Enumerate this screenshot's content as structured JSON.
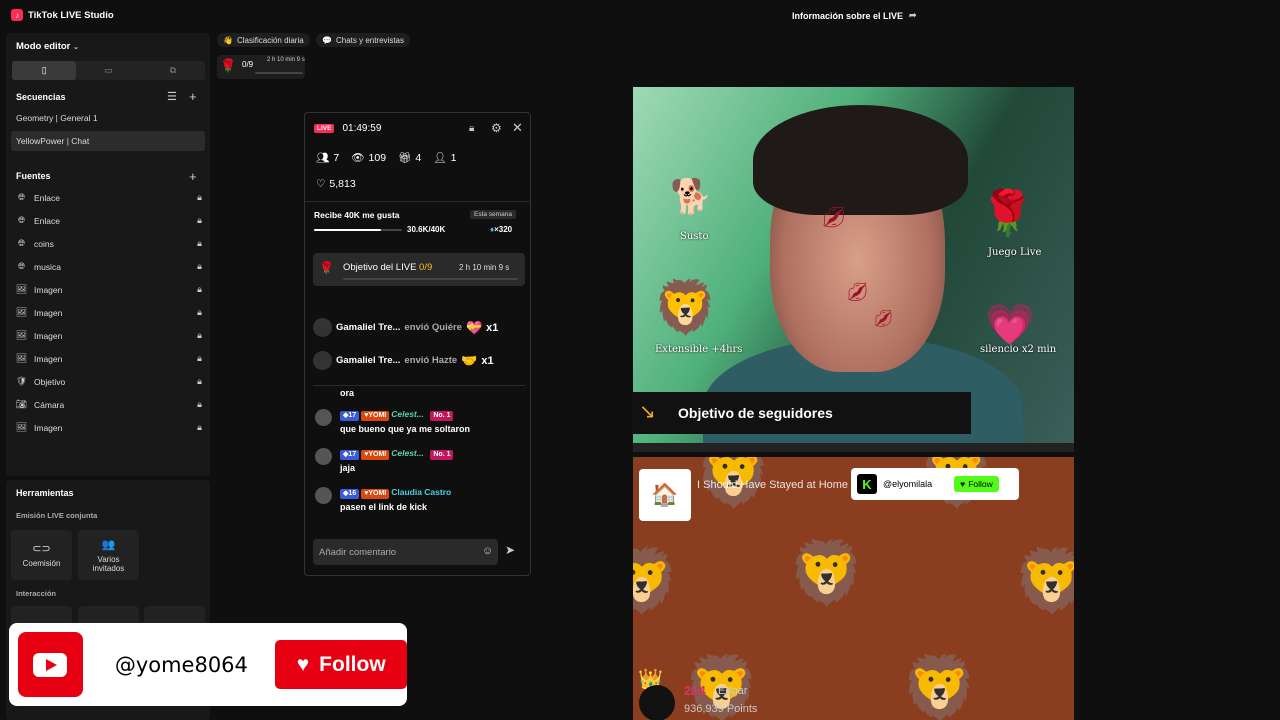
{
  "app": {
    "title": "TikTok LIVE Studio",
    "info_live": "Información sobre el LIVE"
  },
  "sidebar": {
    "mode_editor": "Modo editor",
    "secuencias_title": "Secuencias",
    "secuencias": [
      "Geometry | General 1",
      "YellowPower | Chat"
    ],
    "fuentes_title": "Fuentes",
    "fuentes": [
      {
        "icon": "globe-icon",
        "label": "Enlace"
      },
      {
        "icon": "globe-icon",
        "label": "Enlace"
      },
      {
        "icon": "globe-icon",
        "label": "coins"
      },
      {
        "icon": "globe-icon",
        "label": "musica"
      },
      {
        "icon": "image-icon",
        "label": "Imagen"
      },
      {
        "icon": "image-icon",
        "label": "Imagen"
      },
      {
        "icon": "image-icon",
        "label": "Imagen"
      },
      {
        "icon": "image-icon",
        "label": "Imagen"
      },
      {
        "icon": "shield-icon",
        "label": "Objetivo"
      },
      {
        "icon": "camera-icon",
        "label": "Cámara"
      },
      {
        "icon": "image-icon",
        "label": "Imagen"
      }
    ],
    "herramientas_title": "Herramientas",
    "emision_label": "Emisión LIVE conjunta",
    "coemision": "Coemisión",
    "varios_invitados": "Varios invitados",
    "interaccion_label": "Interacción"
  },
  "chips": {
    "clasificacion": "Clasificación diaria",
    "chats": "Chats y entrevistas"
  },
  "goal_mini": {
    "progress": "0/9",
    "time": "2 h 10 min 9 s"
  },
  "live_panel": {
    "live_badge": "LIVE",
    "timer": "01:49:59",
    "viewers": "7",
    "views": "109",
    "gifts": "4",
    "follows": "1",
    "likes": "5,813",
    "likes_goal_title": "Recibe 40K me gusta",
    "likes_goal_period": "Esta semana",
    "likes_goal_value": "30.6K/40K",
    "likes_goal_fraction": 0.765,
    "likes_goal_reward": "×320",
    "objective_label": "Objetivo del LIVE",
    "objective_progress": "0/9",
    "objective_time": "2 h 10 min 9 s",
    "gift_events": [
      {
        "user": "Gamaliel Tre...",
        "action": "envió Quiére",
        "count": "x1",
        "icon": "heart-gift-icon"
      },
      {
        "user": "Gamaliel Tre...",
        "action": "envió Hazte",
        "count": "x1",
        "icon": "hand-gift-icon"
      }
    ],
    "first_msg": "ora",
    "messages": [
      {
        "level": "17",
        "tag": "YOMI",
        "name": "Celest...",
        "rank": "No. 1",
        "text": "que bueno que ya me soltaron"
      },
      {
        "level": "17",
        "tag": "YOMI",
        "name": "Celest...",
        "rank": "No. 1",
        "text": "jaja"
      },
      {
        "level": "16",
        "tag": "YOMI",
        "name": "Claudia Castro",
        "rank": "",
        "text": "pasen el link de kick"
      }
    ],
    "comment_placeholder": "Añadir comentario"
  },
  "video": {
    "objective_banner": "Objetivo de seguidores",
    "stickers": [
      {
        "emoji": "🐕",
        "label": "Susto"
      },
      {
        "emoji": "🌹",
        "label": "Juego Live"
      },
      {
        "emoji": "🦁",
        "label": "Extensible +4hrs"
      },
      {
        "emoji": "💗",
        "label": "silencio x2 min"
      }
    ]
  },
  "lion_panel": {
    "song_title": "I Should Have Stayed at Home",
    "kick_handle": "@elyomilala",
    "kick_follow": "Follow",
    "points_rank": "214",
    "points_user": "Edgar",
    "points_value": "936,939 Points"
  },
  "yt_banner": {
    "handle": "@yome8064",
    "follow": "Follow"
  },
  "colors": {
    "accent": "#fe2c55",
    "kick": "#53fc18",
    "youtube": "#e60012"
  }
}
